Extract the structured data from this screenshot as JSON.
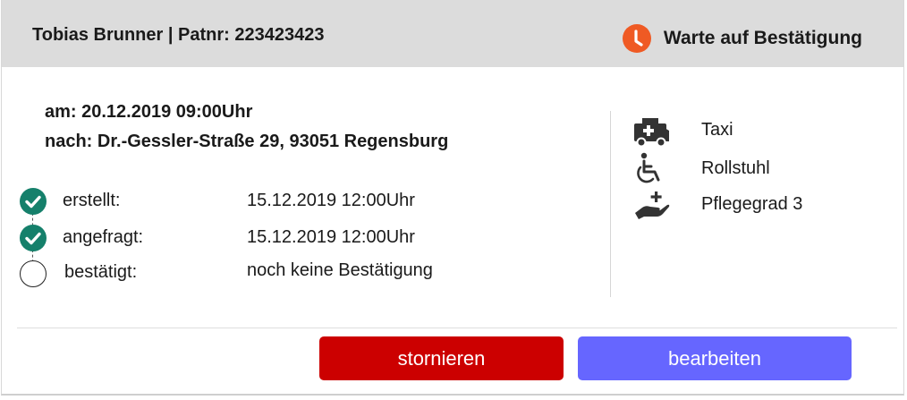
{
  "header": {
    "patient": "Tobias Brunner | Patnr: 223423423",
    "status_label": "Warte auf Bestätigung",
    "status_color": "#ef5a24",
    "status_icon": "clock-icon"
  },
  "appointment": {
    "datetime": "am: 20.12.2019 09:00Uhr",
    "destination": "nach: Dr.-Gessler-Straße 29, 93051 Regensburg"
  },
  "steps": [
    {
      "label": "erstellt:",
      "value": "15.12.2019 12:00Uhr",
      "done": true
    },
    {
      "label": "angefragt:",
      "value": "15.12.2019 12:00Uhr",
      "done": true
    },
    {
      "label": "bestätigt:",
      "value": "noch keine Bestätigung",
      "done": false
    }
  ],
  "features": [
    {
      "icon": "ambulance-icon",
      "label": "Taxi"
    },
    {
      "icon": "wheelchair-icon",
      "label": "Rollstuhl"
    },
    {
      "icon": "care-hand-icon",
      "label": "Pflegegrad 3"
    }
  ],
  "actions": {
    "cancel_label": "stornieren",
    "cancel_color": "#cc0000",
    "edit_label": "bearbeiten",
    "edit_color": "#6666ff"
  }
}
